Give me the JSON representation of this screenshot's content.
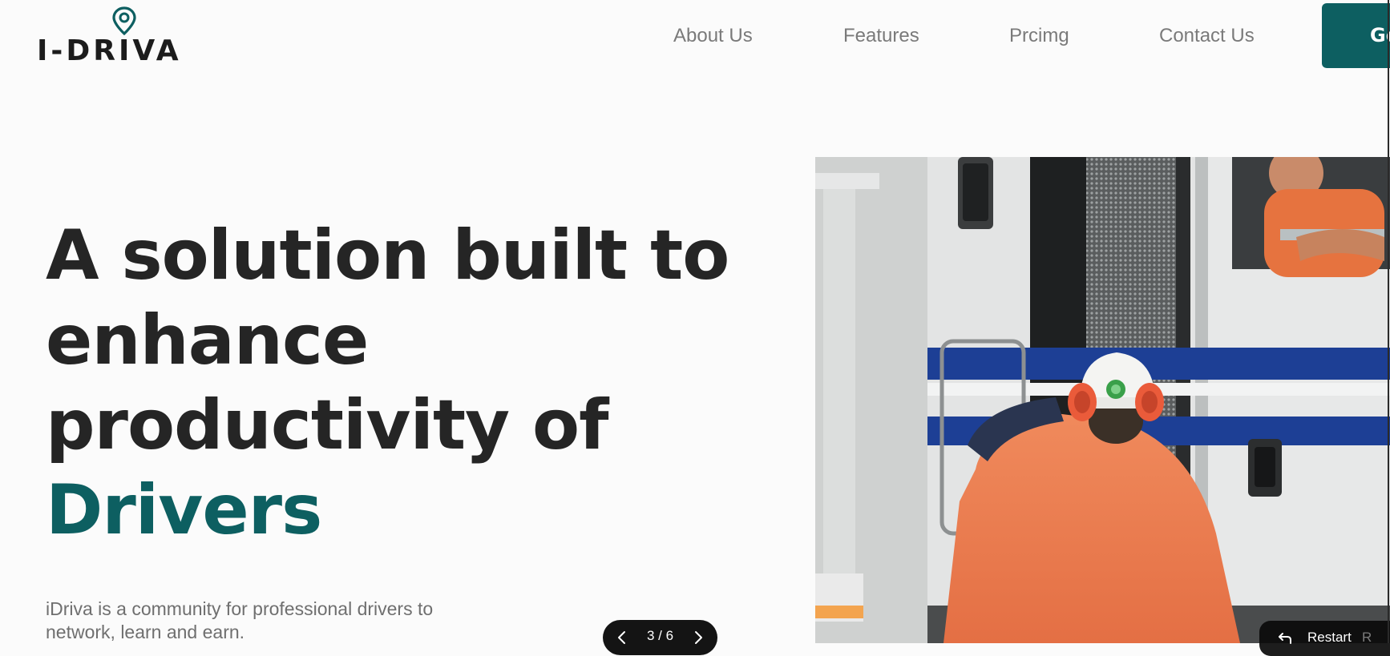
{
  "brand": {
    "name": "I-DRIVA",
    "accent_color": "#0d5f61",
    "icon": "location-pin-icon"
  },
  "nav": {
    "items": [
      {
        "label": "About Us"
      },
      {
        "label": "Features"
      },
      {
        "label": "Prcimg"
      },
      {
        "label": "Contact Us"
      }
    ],
    "cta_label": "Ge"
  },
  "hero": {
    "headline_lines": [
      "A solution built to",
      "enhance",
      "productivity of"
    ],
    "headline_accent": "Drivers",
    "subtitle": "iDriva is a community for professional drivers to network, learn and earn.",
    "slide_counter": "3 / 6",
    "image_icon": "truck-worker-photo"
  },
  "player": {
    "restart_label": "Restart",
    "restart_hint": "R",
    "restart_icon": "restart-arrow-icon"
  }
}
